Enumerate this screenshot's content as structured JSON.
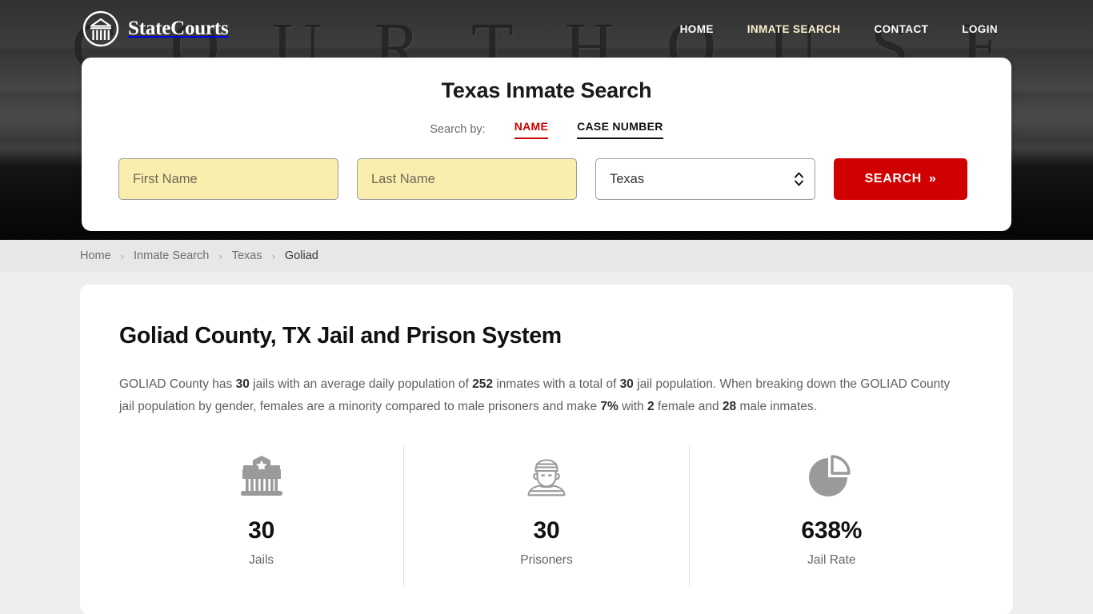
{
  "brand": {
    "name": "StateCourts",
    "logo_icon": "courthouse-circle-icon"
  },
  "nav": {
    "items": [
      {
        "label": "HOME",
        "active": false
      },
      {
        "label": "INMATE SEARCH",
        "active": true
      },
      {
        "label": "CONTACT",
        "active": false
      },
      {
        "label": "LOGIN",
        "active": false
      }
    ]
  },
  "search": {
    "title": "Texas Inmate Search",
    "search_by_label": "Search by:",
    "tabs": [
      {
        "label": "NAME",
        "active": true,
        "color": "#cc0000"
      },
      {
        "label": "CASE NUMBER",
        "active": false,
        "color": "#111111"
      }
    ],
    "first_name_placeholder": "First Name",
    "first_name_value": "",
    "last_name_placeholder": "Last Name",
    "last_name_value": "",
    "state_selected": "Texas",
    "state_options": [
      "Texas"
    ],
    "submit_label": "SEARCH",
    "submit_chevron": "»",
    "submit_color": "#d10000",
    "input_fill": "#faeeaf"
  },
  "breadcrumb": {
    "items": [
      {
        "label": "Home",
        "current": false
      },
      {
        "label": "Inmate Search",
        "current": false
      },
      {
        "label": "Texas",
        "current": false
      },
      {
        "label": "Goliad",
        "current": true
      }
    ],
    "separator": "›"
  },
  "main": {
    "page_title": "Goliad County, TX Jail and Prison System",
    "summary": {
      "parts": [
        {
          "t": "GOLIAD County has ",
          "b": false
        },
        {
          "t": "30",
          "b": true
        },
        {
          "t": " jails with an average daily population of ",
          "b": false
        },
        {
          "t": "252",
          "b": true
        },
        {
          "t": " inmates with a total of ",
          "b": false
        },
        {
          "t": "30",
          "b": true
        },
        {
          "t": " jail population. When breaking down the GOLIAD County jail population by gender, females are a minority compared to male prisoners and make ",
          "b": false
        },
        {
          "t": "7%",
          "b": true
        },
        {
          "t": " with ",
          "b": false
        },
        {
          "t": "2",
          "b": true
        },
        {
          "t": " female and ",
          "b": false
        },
        {
          "t": "28",
          "b": true
        },
        {
          "t": " male inmates.",
          "b": false
        }
      ]
    },
    "stats": [
      {
        "icon": "jail-building-icon",
        "value": "30",
        "label": "Jails"
      },
      {
        "icon": "prisoner-icon",
        "value": "30",
        "label": "Prisoners"
      },
      {
        "icon": "pie-chart-icon",
        "value": "638%",
        "label": "Jail Rate"
      }
    ]
  },
  "hero": {
    "engraved_text": "C O U R T   H O U S E"
  }
}
